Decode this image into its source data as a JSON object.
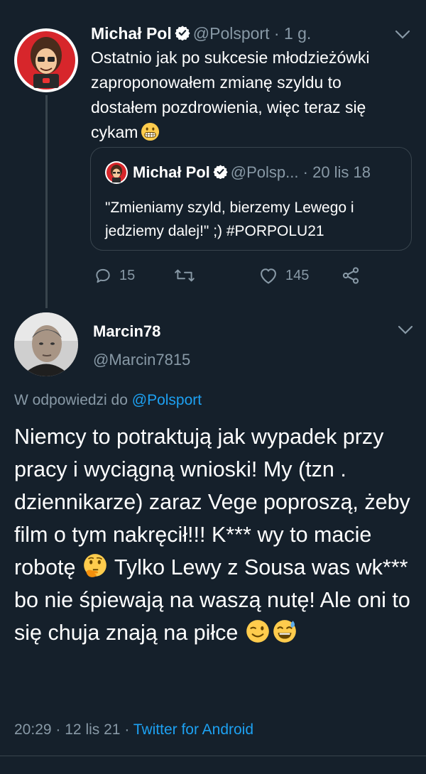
{
  "parent_tweet": {
    "author_name": "Michał Pol",
    "handle": "@Polsport",
    "separator": "·",
    "time": "1 g.",
    "text": "Ostatnio jak po sukcesie młodzieżówki zaproponowałem zmianę szyldu to dostałem pozdrowienia, więc teraz się cykam",
    "emoji": "grimacing-face",
    "quoted": {
      "author_name": "Michał Pol",
      "handle": "@Polsp...",
      "separator": "·",
      "date": "20 lis 18",
      "text": "\"Zmieniamy szyld, bierzemy Lewego i jedziemy dalej!\" ;) #PORPOLU21"
    },
    "actions": {
      "reply_count": "15",
      "retweet_count": "",
      "like_count": "145"
    }
  },
  "reply_tweet": {
    "author_name": "Marcin78",
    "handle": "@Marcin7815",
    "replying_prefix": "W odpowiedzi do",
    "replying_to": "@Polsport",
    "text_part1": "Niemcy to potraktują jak wypadek przy pracy i wyciągną wnioski! My (tzn . dziennikarze) zaraz Vege poproszą, żeby film o tym nakręcił!!! K*** wy to macie robotę",
    "text_part2": " Tylko Lewy z Sousa was wk*** bo nie śpiewają na waszą nutę! Ale oni to się chuja znają na piłce",
    "emojis": [
      "thinking-face",
      "winking-face",
      "grinning-face-with-sweat"
    ],
    "time": "20:29",
    "date": "12 lis 21",
    "source": "Twitter for Android",
    "meta_separator": "·"
  },
  "colors": {
    "background": "#15202b",
    "text": "#ffffff",
    "muted": "#8899a6",
    "accent": "#1da1f2",
    "border": "#38444d"
  }
}
